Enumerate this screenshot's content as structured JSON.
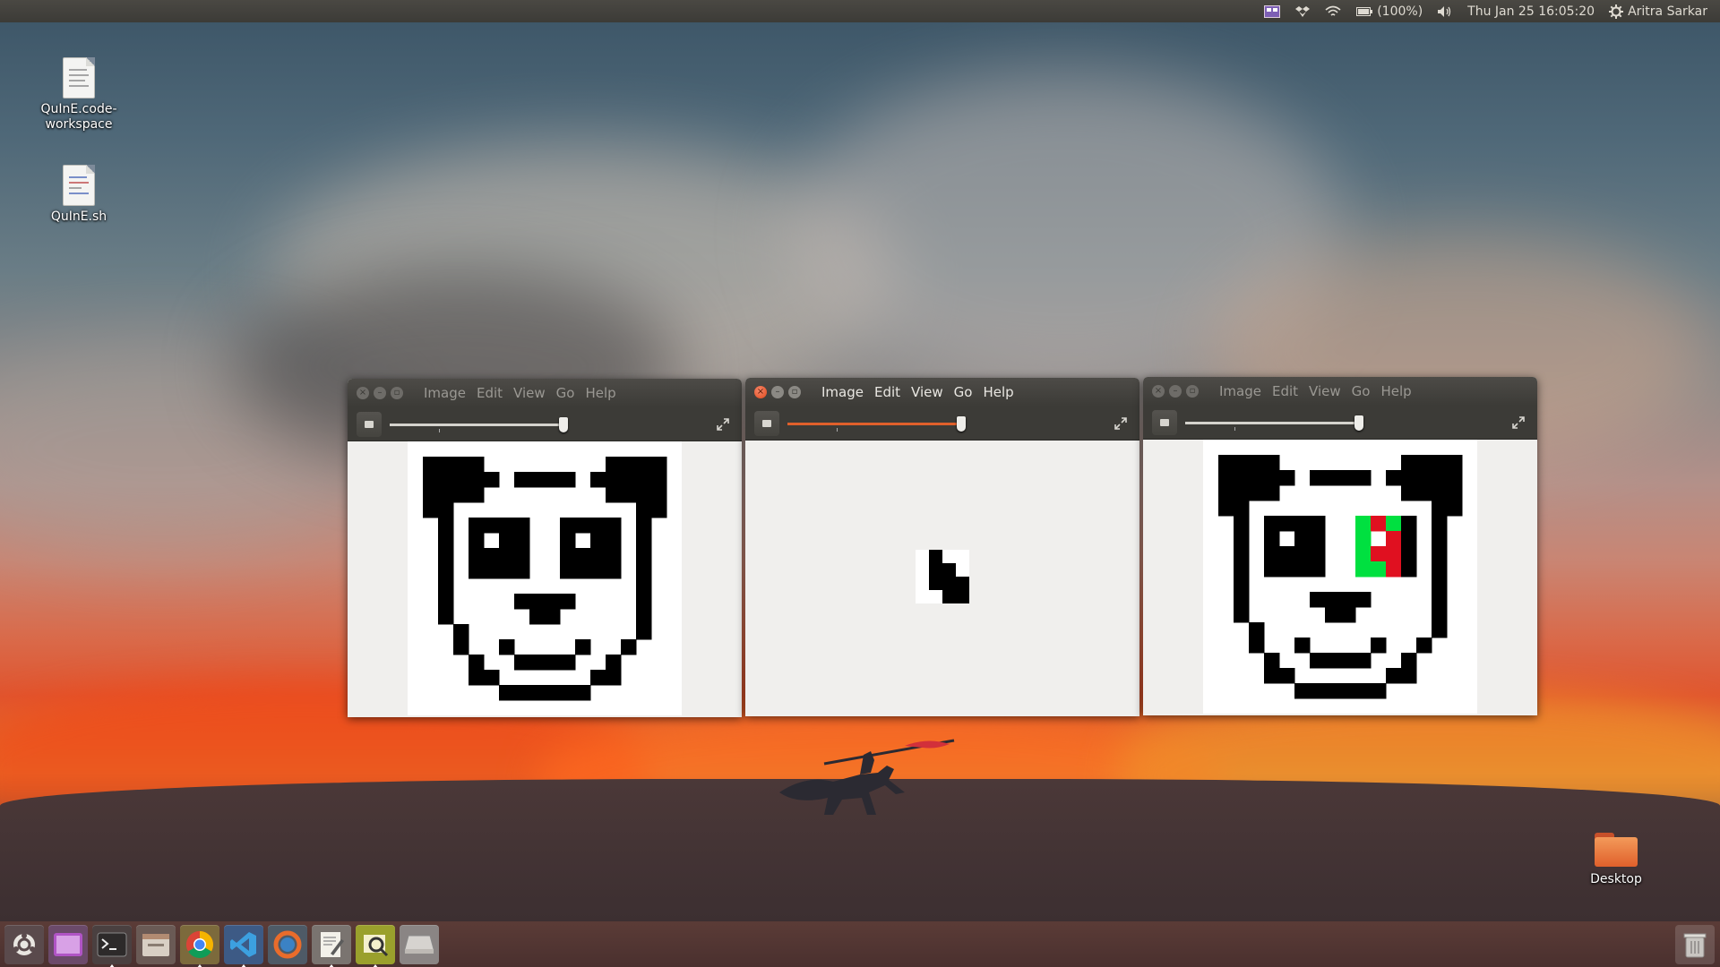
{
  "panel": {
    "battery": "(100%)",
    "datetime": "Thu Jan 25 16:05:20",
    "user": "Aritra Sarkar",
    "icons": [
      "indicator-icon",
      "dropbox-icon",
      "wifi-icon",
      "battery-icon",
      "volume-icon",
      "gear-icon"
    ]
  },
  "desktop": {
    "files": [
      {
        "label": "QuInE.code-\nworkspace",
        "icon": "document-icon"
      },
      {
        "label": "QuInE.sh",
        "icon": "script-icon"
      }
    ],
    "folder": {
      "label": "Desktop",
      "icon": "folder-icon"
    }
  },
  "windows": [
    {
      "menus": [
        "Image",
        "Edit",
        "View",
        "Go",
        "Help"
      ],
      "zoom_fraction": 1.0,
      "active": false,
      "image": "panda"
    },
    {
      "menus": [
        "Image",
        "Edit",
        "View",
        "Go",
        "Help"
      ],
      "zoom_fraction": 1.0,
      "active": true,
      "image": "fragment"
    },
    {
      "menus": [
        "Image",
        "Edit",
        "View",
        "Go",
        "Help"
      ],
      "zoom_fraction": 1.0,
      "active": false,
      "image": "panda-colored-eye"
    }
  ],
  "launcher": {
    "items": [
      "dash-icon",
      "workspaces-icon",
      "terminal-icon",
      "file-manager-icon",
      "chrome-icon",
      "vscode-icon",
      "software-updater-icon",
      "text-editor-icon",
      "image-viewer-icon",
      "drive-icon"
    ],
    "trash": "trash-icon"
  },
  "colors": {
    "accent": "#e0602b",
    "panel": "#3c3b37",
    "green": "#00e040",
    "red": "#e01020"
  }
}
